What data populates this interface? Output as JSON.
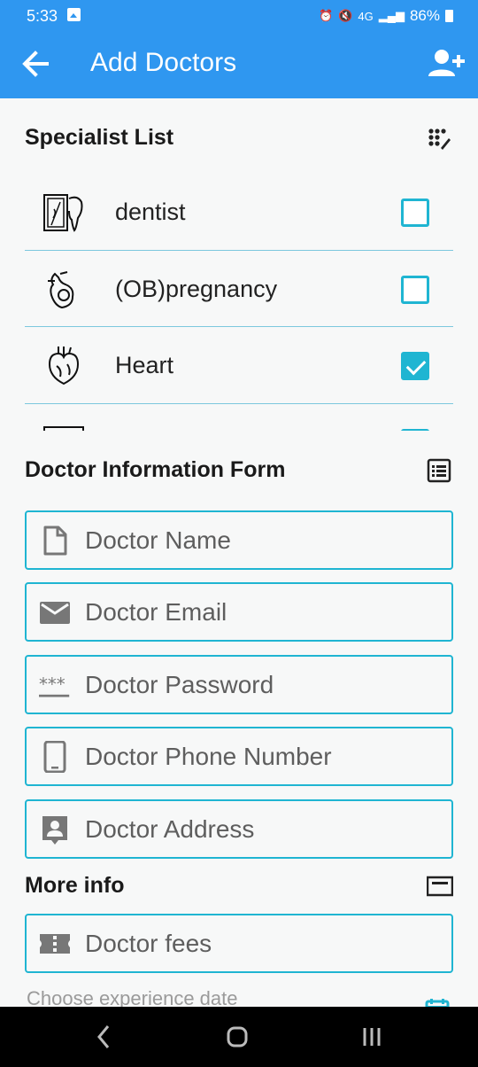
{
  "status_bar": {
    "time": "5:33",
    "network": "4G",
    "battery": "86%"
  },
  "app_bar": {
    "title": "Add Doctors",
    "back_icon": "arrow-left-icon",
    "action_icon": "person-add-icon"
  },
  "specialist_section": {
    "title": "Specialist List",
    "icon": "dots-edit-icon",
    "items": [
      {
        "label": "dentist",
        "icon": "tooth-icon",
        "checked": false
      },
      {
        "label": "(OB)pregnancy",
        "icon": "pregnancy-icon",
        "checked": false
      },
      {
        "label": "Heart",
        "icon": "heart-organ-icon",
        "checked": true
      },
      {
        "label": "",
        "icon": "xray-icon",
        "checked": true
      }
    ]
  },
  "doctor_form": {
    "title": "Doctor Information Form",
    "icon": "list-form-icon",
    "fields": [
      {
        "placeholder": "Doctor Name",
        "icon": "file-icon"
      },
      {
        "placeholder": "Doctor Email",
        "icon": "mail-icon"
      },
      {
        "placeholder": "Doctor Password",
        "icon": "password-icon"
      },
      {
        "placeholder": "Doctor Phone Number",
        "icon": "phone-icon"
      },
      {
        "placeholder": "Doctor Address",
        "icon": "contact-icon"
      }
    ]
  },
  "more_info": {
    "title": "More info",
    "icon": "card-icon",
    "fees": {
      "placeholder": "Doctor fees",
      "icon": "ticket-icon"
    },
    "experience_label": "Choose experience date",
    "calendar_icon": "calendar-icon"
  },
  "colors": {
    "app_bar": "#2f97f0",
    "accent": "#1fb5d2",
    "divider": "#7cc8de",
    "background": "#f7f8f8"
  }
}
